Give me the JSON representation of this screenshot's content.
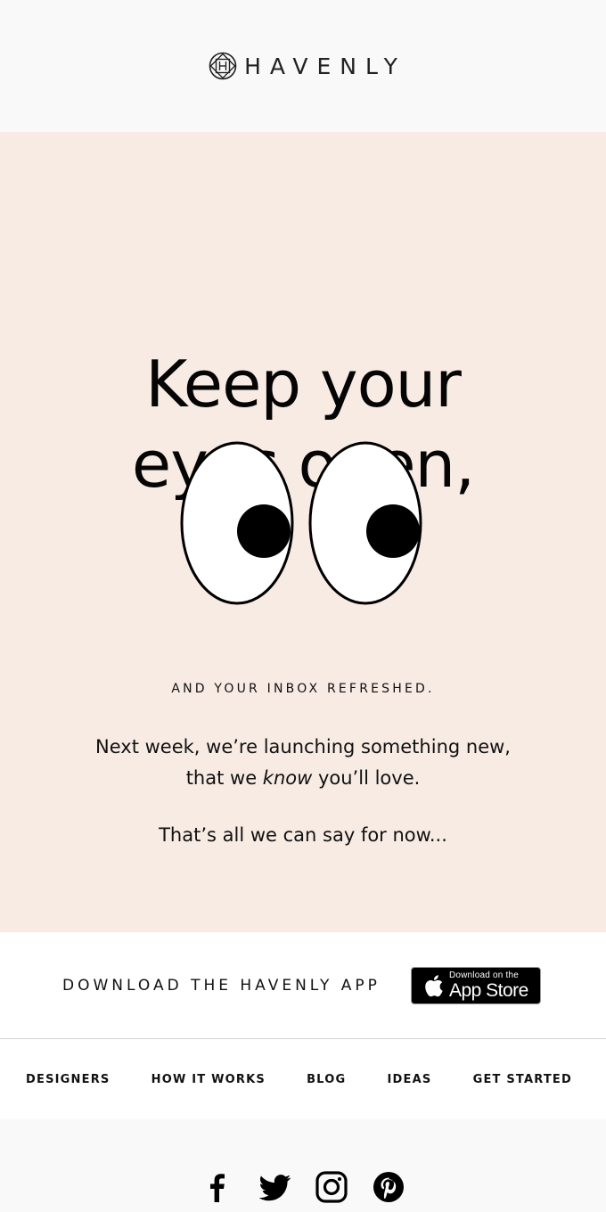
{
  "header": {
    "brand_name": "HAVENLY",
    "logo_icon": "havenly-monogram-icon"
  },
  "hero": {
    "headline_line1": "Keep your",
    "headline_line2": "eyes open,",
    "illustration": "googly-eyes-illustration",
    "tagline": "AND YOUR INBOX REFRESHED.",
    "body_line1": "Next week, we’re launching something new,",
    "body_line2_before": "that we ",
    "body_line2_emphasis": "know",
    "body_line2_after": " you’ll love.",
    "closing": "That’s all we can say for now...",
    "background_color": "#f8ebe4"
  },
  "app_promo": {
    "label": "DOWNLOAD THE HAVENLY APP",
    "badge_small": "Download on the",
    "badge_big": "App Store",
    "badge_icon": "apple-icon"
  },
  "nav": {
    "items": [
      {
        "label": "DESIGNERS"
      },
      {
        "label": "HOW IT WORKS"
      },
      {
        "label": "BLOG"
      },
      {
        "label": "IDEAS"
      },
      {
        "label": "GET STARTED"
      }
    ]
  },
  "footer": {
    "social": [
      {
        "name": "facebook-icon"
      },
      {
        "name": "twitter-icon"
      },
      {
        "name": "instagram-icon"
      },
      {
        "name": "pinterest-icon"
      }
    ]
  }
}
